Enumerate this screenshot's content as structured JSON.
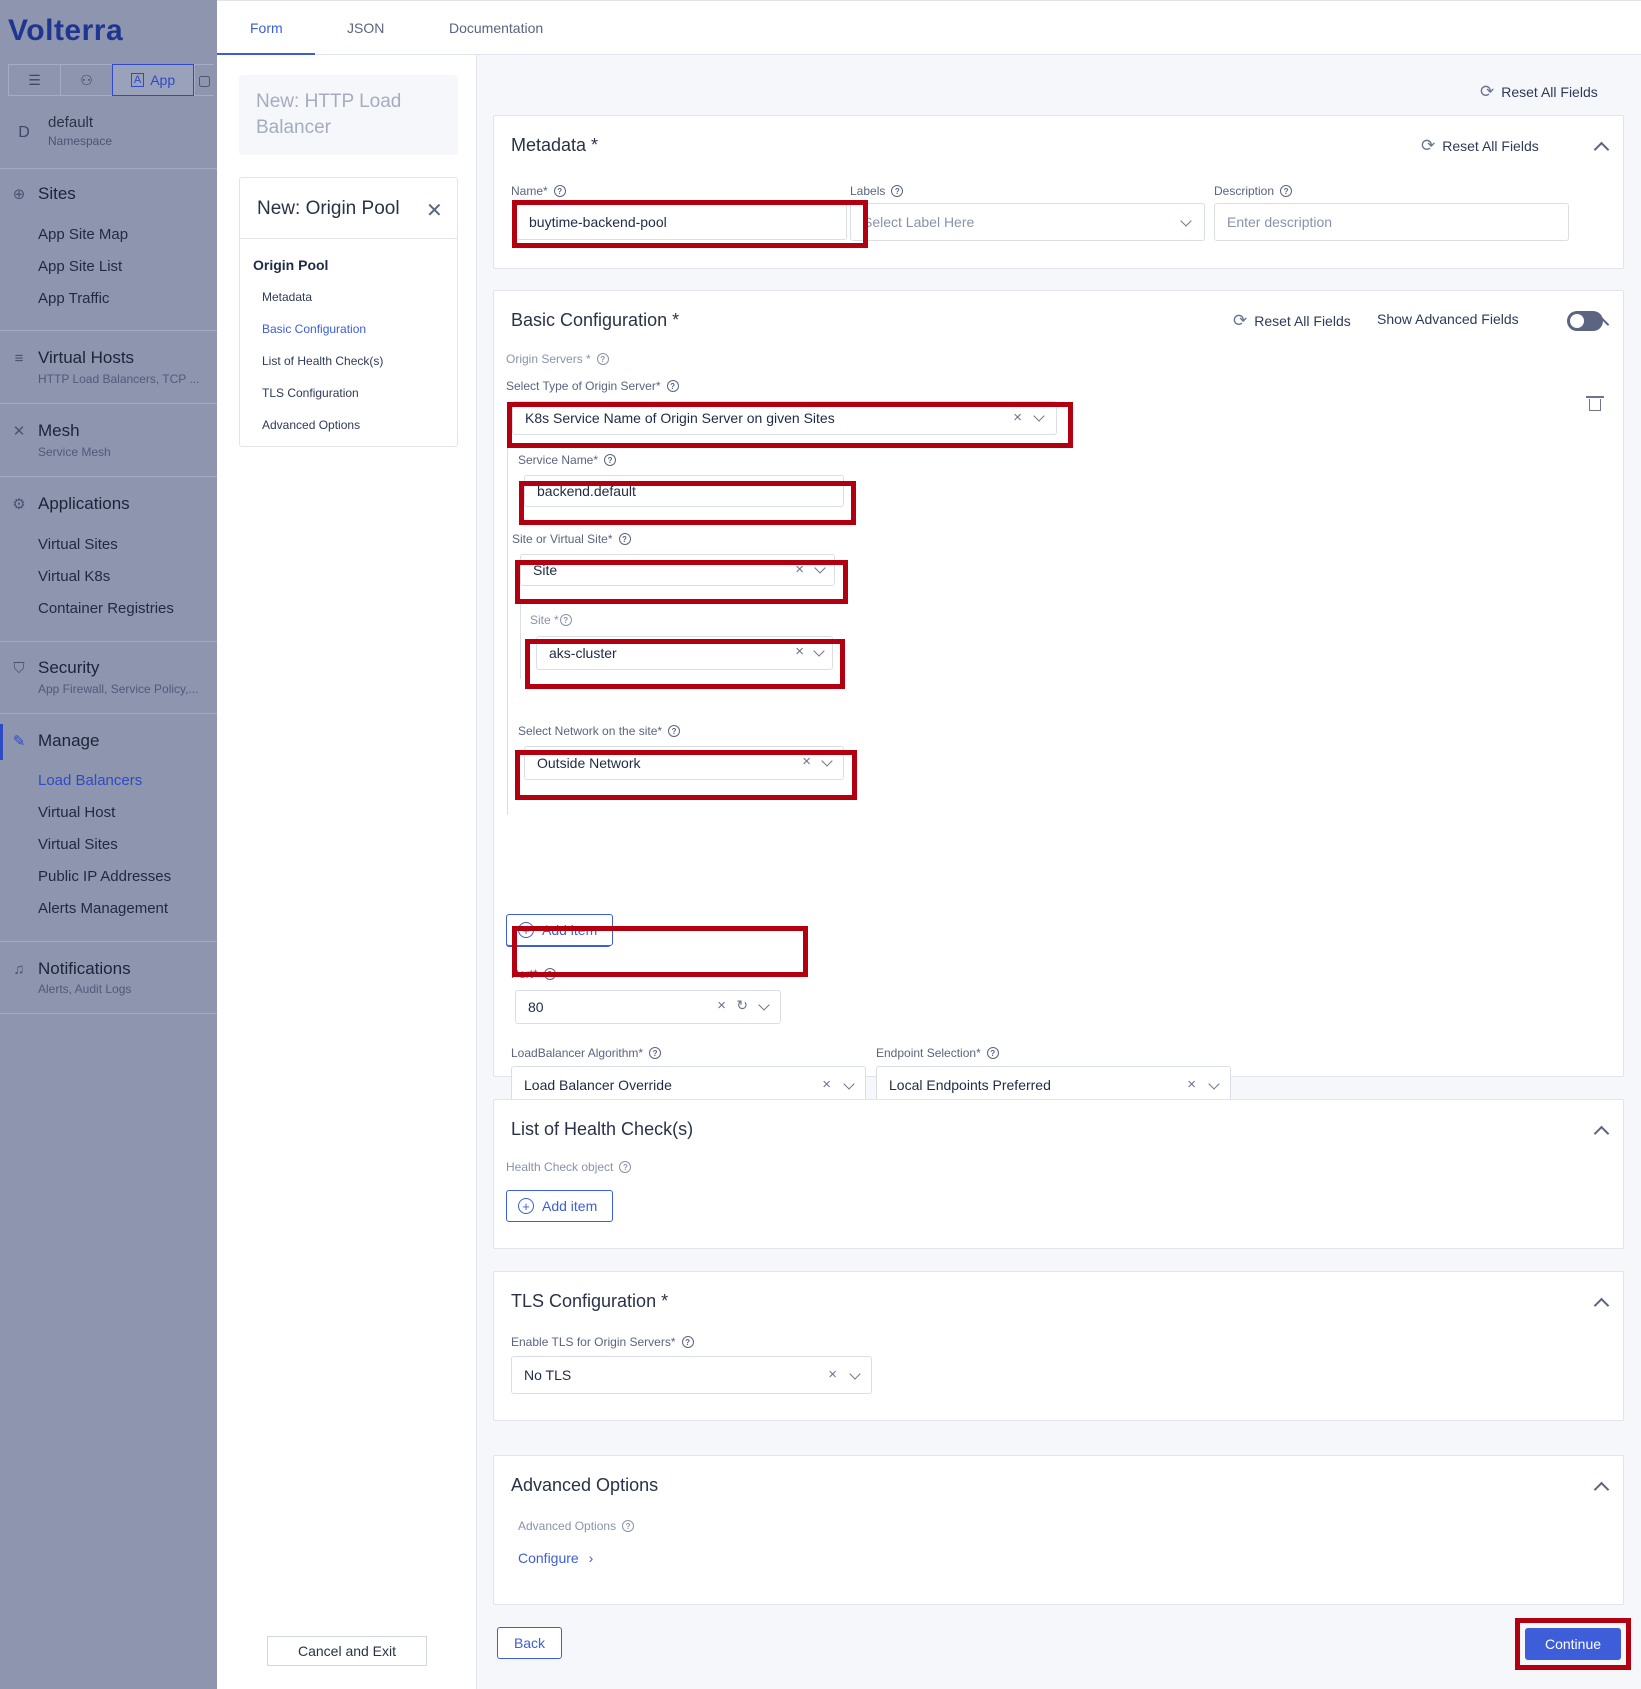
{
  "sidebar": {
    "logo": "Volterra",
    "mode_tabs": {
      "app": "App"
    },
    "namespace": {
      "avatar": "D",
      "name": "default",
      "label": "Namespace"
    },
    "sections": [
      {
        "title": "Sites",
        "items": [
          "App Site Map",
          "App Site List",
          "App Traffic"
        ]
      },
      {
        "title": "Virtual Hosts",
        "subtitle": "HTTP Load Balancers, TCP ..."
      },
      {
        "title": "Mesh",
        "subtitle": "Service Mesh"
      },
      {
        "title": "Applications",
        "items": [
          "Virtual Sites",
          "Virtual K8s",
          "Container Registries"
        ]
      },
      {
        "title": "Security",
        "subtitle": "App Firewall, Service Policy,..."
      },
      {
        "title": "Manage",
        "items": [
          "Load Balancers",
          "Virtual Host",
          "Virtual Sites",
          "Public IP Addresses",
          "Alerts Management"
        ]
      },
      {
        "title": "Notifications",
        "subtitle": "Alerts, Audit Logs"
      }
    ]
  },
  "midpanel": {
    "lb_card": "New: HTTP Load Balancer",
    "op_title": "New: Origin Pool",
    "op_head": "Origin Pool",
    "op_links": [
      "Metadata",
      "Basic Configuration",
      "List of Health Check(s)",
      "TLS Configuration",
      "Advanced Options"
    ],
    "cancel": "Cancel and Exit"
  },
  "tabs": [
    "Form",
    "JSON",
    "Documentation"
  ],
  "top_reset": "Reset All Fields",
  "metadata": {
    "title": "Metadata *",
    "reset": "Reset All Fields",
    "name_label": "Name*",
    "name_value": "buytime-backend-pool",
    "labels_label": "Labels",
    "labels_placeholder": "Select Label Here",
    "desc_label": "Description",
    "desc_placeholder": "Enter description"
  },
  "basic": {
    "title": "Basic Configuration *",
    "reset": "Reset All Fields",
    "show_advanced": "Show Advanced Fields",
    "origin_servers_label": "Origin Servers *",
    "type_label": "Select Type of Origin Server*",
    "type_value": "K8s Service Name of Origin Server on given Sites",
    "service_name_label": "Service Name*",
    "service_name_value": "backend.default",
    "site_or_vsite_label": "Site or Virtual Site*",
    "site_or_vsite_value": "Site",
    "site_label": "Site *",
    "site_value": "aks-cluster",
    "network_label": "Select Network on the site*",
    "network_value": "Outside Network",
    "add_item": "Add item",
    "port_label": "Port*",
    "port_value": "80",
    "lb_algo_label": "LoadBalancer Algorithm*",
    "lb_algo_value": "Load Balancer Override",
    "endpoint_label": "Endpoint Selection*",
    "endpoint_value": "Local Endpoints Preferred"
  },
  "health": {
    "title": "List of Health Check(s)",
    "object_label": "Health Check object",
    "add_item": "Add item"
  },
  "tls": {
    "title": "TLS Configuration *",
    "enable_label": "Enable TLS for Origin Servers*",
    "enable_value": "No TLS"
  },
  "advanced": {
    "title": "Advanced Options",
    "label": "Advanced Options",
    "configure": "Configure"
  },
  "footer": {
    "back": "Back",
    "continue": "Continue"
  }
}
